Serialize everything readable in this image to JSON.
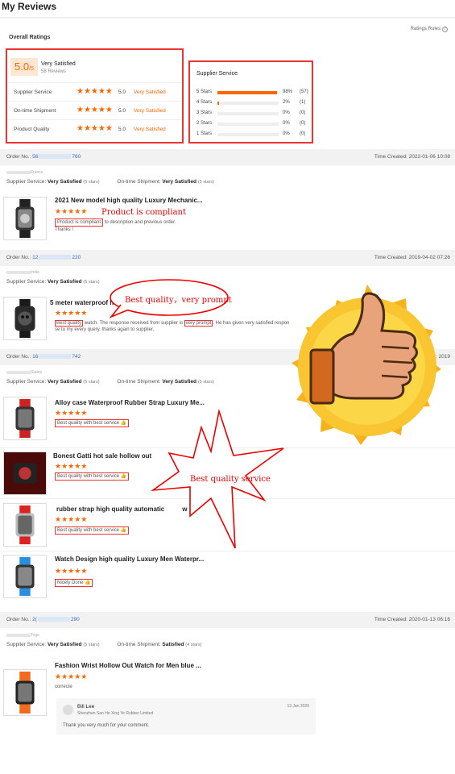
{
  "page": {
    "title": "My Reviews"
  },
  "overall": {
    "label": "Overall Ratings",
    "rules": "Ratings Rules",
    "score": "5.0",
    "score_of": "/5",
    "verdict": "Very Satisfied",
    "reviews": "58 Reviews",
    "rows": [
      {
        "label": "Supplier Service",
        "stars": "★★★★★",
        "value": "5.0",
        "text": "Very Satisfied"
      },
      {
        "label": "On-time Shipment",
        "stars": "★★★★★",
        "value": "5.0",
        "text": "Very Satisfied"
      },
      {
        "label": "Product Quality",
        "stars": "★★★★★",
        "value": "5.0",
        "text": "Very Satisfied"
      }
    ]
  },
  "supplier_service": {
    "title": "Supplier Service",
    "rows": [
      {
        "label": "5 Stars",
        "pct": "98%",
        "count": "(57)",
        "fraction": 0.98
      },
      {
        "label": "4 Stars",
        "pct": "2%",
        "count": "(1)",
        "fraction": 0.02
      },
      {
        "label": "3 Stars",
        "pct": "0%",
        "count": "(0)",
        "fraction": 0
      },
      {
        "label": "2 Stars",
        "pct": "0%",
        "count": "(0)",
        "fraction": 0
      },
      {
        "label": "1 Stars",
        "pct": "0%",
        "count": "(0)",
        "fraction": 0
      }
    ]
  },
  "common": {
    "order_no": "Order No.:",
    "supplier_service": "Supplier Service:",
    "ontime": "On-time Shipment:",
    "very_satisfied": "Very Satisfied",
    "satisfied": "Satisfied",
    "five_stars": "(5 stars)",
    "four_stars": "(4 stars)",
    "stars5": "★★★★★"
  },
  "orders": [
    {
      "prefix": "56",
      "suffix": "760",
      "time": "Time Created: 2022-01-06 10:08",
      "country": "France"
    },
    {
      "prefix": "12",
      "suffix": "220",
      "time": "Time Created: 2019-04-02 07:26",
      "country": "India"
    },
    {
      "prefix": "16",
      "suffix": "742",
      "time": "Time Created: 2019",
      "country": "States"
    },
    {
      "prefix": "2(",
      "suffix": "290",
      "time": "Time Created: 2020-01-13 06:16",
      "country": "Togo"
    }
  ],
  "reviews": [
    {
      "title": "2021 New model high quality Luxury Mechanic...",
      "highlight": "Product is compliant",
      "rest": " to description and previous order.",
      "line2": "Thanks !"
    },
    {
      "title": "5 meter waterproof h",
      "highlight": "Best quality",
      "mid": " watch. The response received from supplier is ",
      "highlight2": "very prompt",
      "rest": ". He has given very satisfied respon",
      "line2": "se to my every query. thanks again to supplier."
    },
    {
      "title": "Alloy case Waterproof Rubber Strap Luxury Me...",
      "comment": "Best quality with best service 👍"
    },
    {
      "title": "Bonest Gatti hot sale hollow out",
      "comment": "Best quality with best service 👍"
    },
    {
      "title": "rubber strap high quality automatic",
      "tail": "w",
      "comment": "Best quality with best service 👍"
    },
    {
      "title": "Watch Design high quality Luxury Men Waterpr...",
      "comment": "Nicely Done 👍"
    },
    {
      "title": "Fashion Wrist Hollow Out Watch for Men blue ...",
      "comment": "correcte"
    }
  ],
  "reply": {
    "name": "Bill Lee",
    "company": "Shenzhen San He Xing Ye Rubber Limited",
    "date": "13 Jan 2020",
    "message": "Thank you very much for your comment."
  },
  "annotations": {
    "compliant": "Product is compliant",
    "prompt": "Best quality，very prompt",
    "service": "Best quality service"
  },
  "colors": {
    "accent": "#ff6600",
    "highlight_red": "#e33333",
    "link_blue": "#3366cc"
  }
}
